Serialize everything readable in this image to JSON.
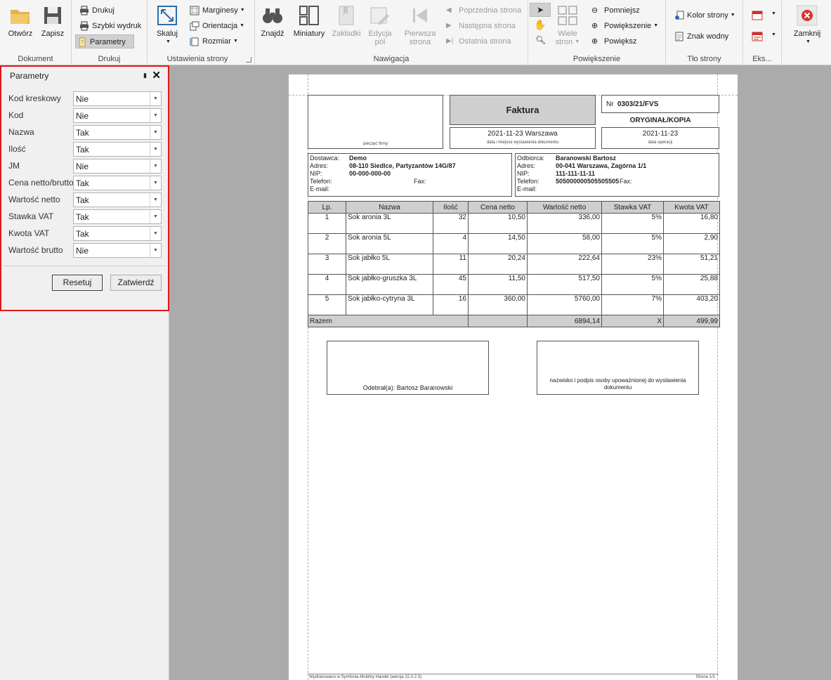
{
  "ribbon": {
    "dokument": {
      "label": "Dokument",
      "open": "Otwórz",
      "save": "Zapisz"
    },
    "drukuj": {
      "label": "Drukuj",
      "print": "Drukuj",
      "quick_print": "Szybki wydruk",
      "params": "Parametry"
    },
    "ustawienia": {
      "label": "Ustawienia strony",
      "scale": "Skaluj",
      "margins": "Marginesy",
      "orientation": "Orientacja",
      "size": "Rozmiar"
    },
    "nawigacja": {
      "label": "Nawigacja",
      "find": "Znajdź",
      "thumbnails": "Miniatury",
      "bookmarks": "Zakładki",
      "edit_fields_1": "Edycja",
      "edit_fields_2": "pól",
      "first_page_1": "Pierwsza",
      "first_page_2": "strona",
      "prev_page": "Poprzednia strona",
      "next_page": "Następna strona",
      "last_page": "Ostatnia strona"
    },
    "powiekszenie": {
      "label": "Powiększenie",
      "many_pages_1": "Wiele",
      "many_pages_2": "stron",
      "zoom_out": "Pomniejsz",
      "zoom": "Powiększenie",
      "zoom_in": "Powiększ"
    },
    "tlo": {
      "label": "Tło strony",
      "page_color": "Kolor strony",
      "watermark": "Znak wodny"
    },
    "eksport": {
      "label": "Eks..."
    },
    "zamknij": {
      "close": "Zamknij"
    }
  },
  "params_panel": {
    "title": "Parametry",
    "rows": [
      {
        "label": "Kod kreskowy",
        "value": "Nie"
      },
      {
        "label": "Kod",
        "value": "Nie"
      },
      {
        "label": "Nazwa",
        "value": "Tak"
      },
      {
        "label": "Ilość",
        "value": "Tak"
      },
      {
        "label": "JM",
        "value": "Nie"
      },
      {
        "label": "Cena netto/brutto",
        "value": "Tak"
      },
      {
        "label": "Wartość netto",
        "value": "Tak"
      },
      {
        "label": "Stawka VAT",
        "value": "Tak"
      },
      {
        "label": "Kwota VAT",
        "value": "Tak"
      },
      {
        "label": "Wartość brutto",
        "value": "Nie"
      }
    ],
    "reset": "Resetuj",
    "confirm": "Zatwierdź"
  },
  "invoice": {
    "stamp_caption": "pieczęć firmy",
    "title": "Faktura",
    "number_prefix": "Nr",
    "number": "0303/21/FVS",
    "copy_label": "ORYGINAŁ/KOPIA",
    "issue_place_date": "2021-11-23 Warszawa",
    "issue_caption": "data i miejsce wystawienia dokumentu",
    "operation_date": "2021-11-23",
    "operation_caption": "data operacji",
    "supplier": {
      "label": "Dostawca:",
      "name": "Demo",
      "address_label": "Adres:",
      "address": "08-110 Siedlce, Partyzantów 14G/87",
      "nip_label": "NIP:",
      "nip": "00-000-000-00",
      "phone_label": "Telefon:",
      "fax_label": "Fax:",
      "email_label": "E-mail:"
    },
    "buyer": {
      "label": "Odbiorca:",
      "name": "Baranowski Bartosz",
      "address_label": "Adres:",
      "address": "00-041 Warszawa, Zagórna 1/1",
      "nip_label": "NIP:",
      "nip": "111-111-11-11",
      "phone_label": "Telefon:",
      "phone": "505000000505505505",
      "fax_label": "Fax:",
      "email_label": "E-mail:"
    },
    "table": {
      "headers": [
        "Lp.",
        "Nazwa",
        "Ilość",
        "Cena netto",
        "Wartość netto",
        "Stawka VAT",
        "Kwota VAT"
      ],
      "rows": [
        {
          "lp": "1",
          "name": "Sok aronia 3L",
          "qty": "32",
          "price": "10,50",
          "net": "336,00",
          "vat_rate": "5%",
          "vat": "16,80"
        },
        {
          "lp": "2",
          "name": "Sok aronia 5L",
          "qty": "4",
          "price": "14,50",
          "net": "58,00",
          "vat_rate": "5%",
          "vat": "2,90"
        },
        {
          "lp": "3",
          "name": "Sok jabłko 5L",
          "qty": "11",
          "price": "20,24",
          "net": "222,64",
          "vat_rate": "23%",
          "vat": "51,21"
        },
        {
          "lp": "4",
          "name": "Sok jabłko-gruszka 3L",
          "qty": "45",
          "price": "11,50",
          "net": "517,50",
          "vat_rate": "5%",
          "vat": "25,88"
        },
        {
          "lp": "5",
          "name": "Sok jabłko-cytryna 3L",
          "qty": "16",
          "price": "360,00",
          "net": "5760,00",
          "vat_rate": "7%",
          "vat": "403,20"
        }
      ],
      "sum_label": "Razem",
      "sum_net": "6894,14",
      "sum_vat_rate": "X",
      "sum_vat": "499,99"
    },
    "received_by": "Odebrał(a): Bartosz Baranowski",
    "signature_caption": "nazwisko i podpis osoby upoważnionej do wystawienia dokumentu",
    "footer_left": "Wydrukowano w Symfonia Mobilny Handel (wersja 22.0.2.3)",
    "footer_right": "Strona 1/1"
  },
  "colors": {
    "accent_red": "#e01818",
    "close_red": "#d9342b"
  }
}
